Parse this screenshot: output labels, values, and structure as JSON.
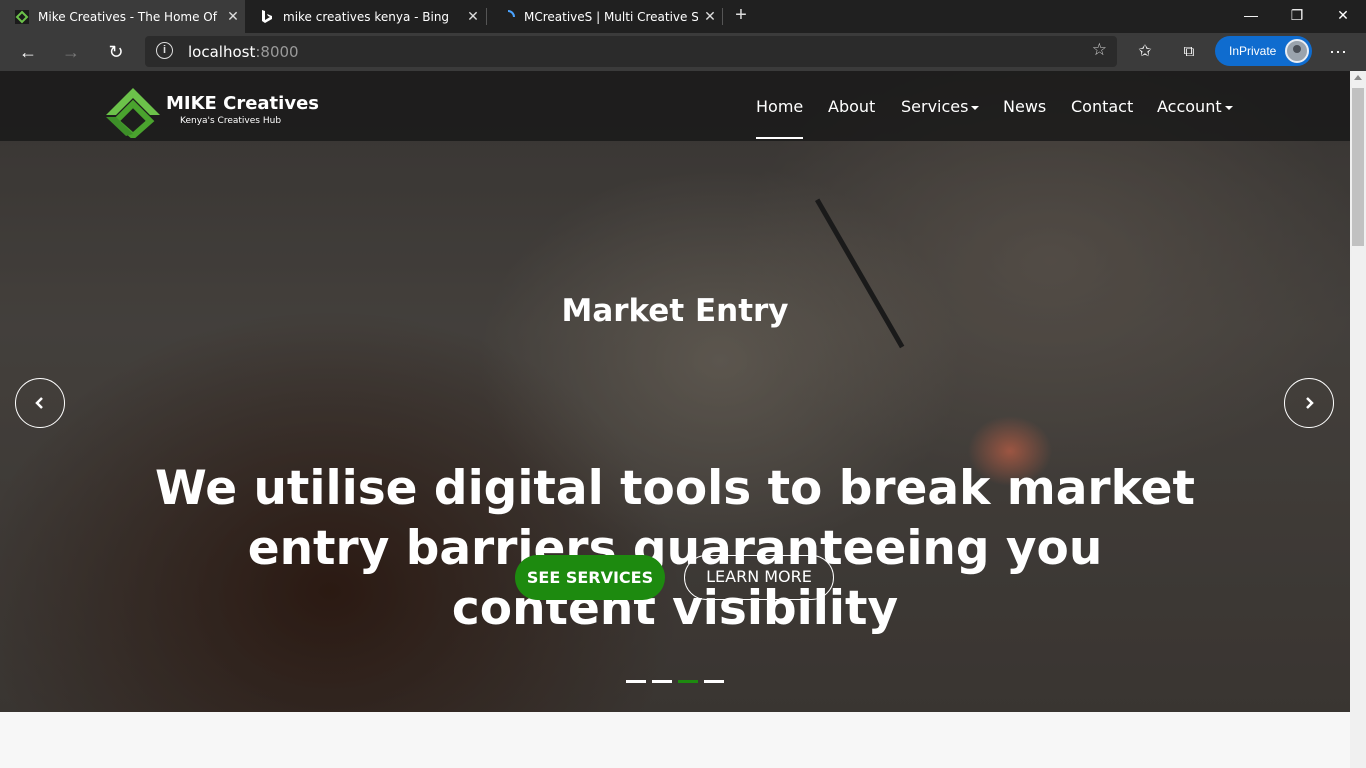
{
  "browser": {
    "tabs": [
      {
        "title": "Mike Creatives - The Home Of Ke",
        "favicon": "mike-creatives-logo",
        "active": true
      },
      {
        "title": "mike creatives kenya - Bing",
        "favicon": "bing-logo",
        "active": false
      },
      {
        "title": "MCreativeS | Multi Creative Solut",
        "favicon": "loading-spinner",
        "active": false
      }
    ],
    "address": {
      "host": "localhost",
      "port": ":8000"
    },
    "inprivate_label": "InPrivate"
  },
  "site": {
    "brand": "MIKE Creatives",
    "tagline": "Kenya's Creatives Hub",
    "nav": [
      {
        "label": "Home",
        "active": true,
        "dropdown": false
      },
      {
        "label": "About",
        "active": false,
        "dropdown": false
      },
      {
        "label": "Services",
        "active": false,
        "dropdown": true
      },
      {
        "label": "News",
        "active": false,
        "dropdown": false
      },
      {
        "label": "Contact",
        "active": false,
        "dropdown": false
      },
      {
        "label": "Account",
        "active": false,
        "dropdown": true
      }
    ],
    "slide": {
      "subtitle": "Market Entry",
      "headline": "We utilise digital tools to break market entry barriers guaranteeing you content visibility",
      "primary_button": "SEE SERVICES",
      "secondary_button": "LEARN MORE",
      "indicator_count": 4,
      "active_indicator": 3
    }
  },
  "colors": {
    "accent_green": "#1d8a0f",
    "inprivate_blue": "#0f6ccf"
  }
}
